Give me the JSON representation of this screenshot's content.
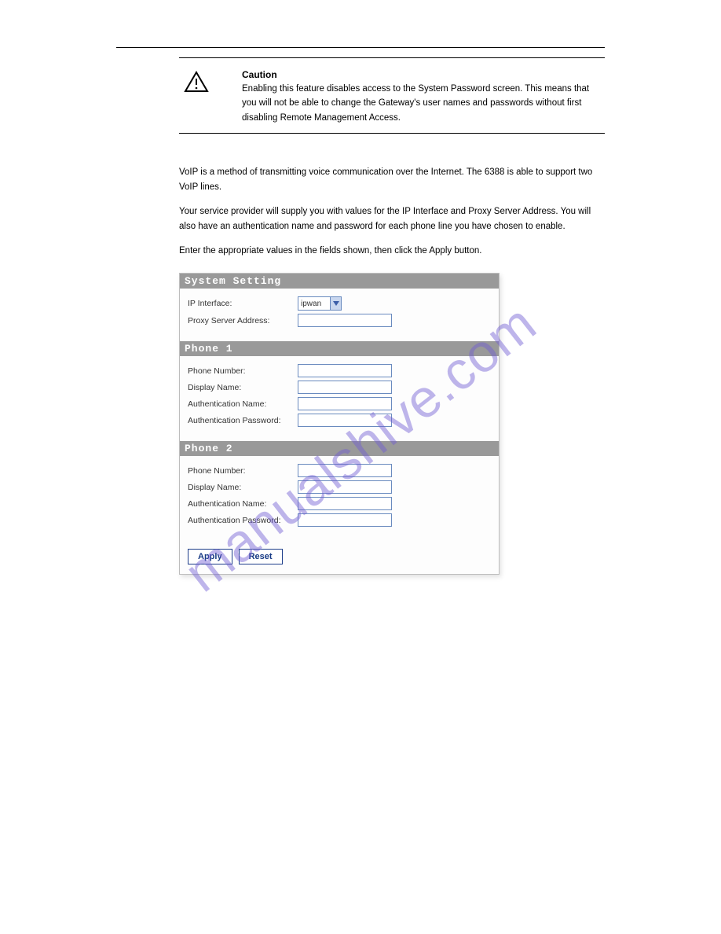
{
  "watermark": "manualshive.com",
  "caution": {
    "title": "Caution",
    "body": "Enabling this feature disables access to the System Password screen. This means that you will not be able to change the Gateway's user names and passwords without first disabling Remote Management Access."
  },
  "paragraphs": {
    "p1": "VoIP is a method of transmitting voice communication over the Internet. The 6388 is able to support two VoIP lines.",
    "p2": "Your service provider will supply you with values for the IP Interface and Proxy Server Address. You will also have an authentication name and password for each phone line you have chosen to enable.",
    "p3": "Enter the appropriate values in the fields shown, then click the Apply button."
  },
  "form": {
    "system": {
      "header": "System Setting",
      "ip_interface_label": "IP Interface:",
      "ip_interface_value": "ipwan",
      "proxy_label": "Proxy Server Address:"
    },
    "phone1": {
      "header": "Phone 1",
      "phone_number_label": "Phone Number:",
      "display_name_label": "Display Name:",
      "auth_name_label": "Authentication Name:",
      "auth_pw_label": "Authentication Password:"
    },
    "phone2": {
      "header": "Phone 2",
      "phone_number_label": "Phone Number:",
      "display_name_label": "Display Name:",
      "auth_name_label": "Authentication Name:",
      "auth_pw_label": "Authentication Password:"
    },
    "buttons": {
      "apply": "Apply",
      "reset": "Reset"
    }
  }
}
